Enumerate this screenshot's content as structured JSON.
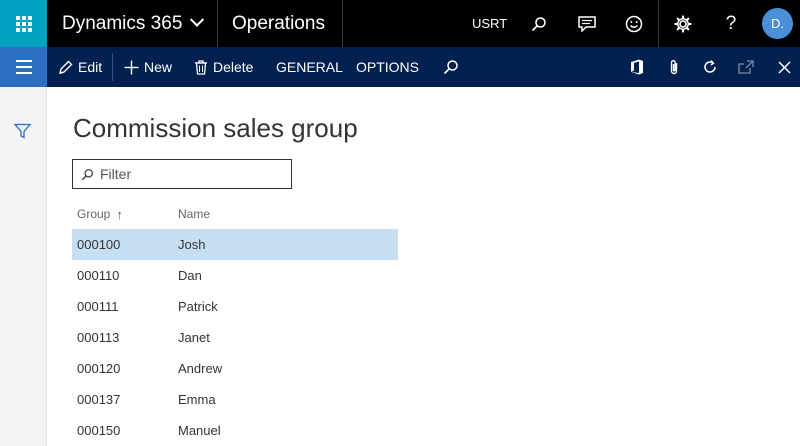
{
  "topbar": {
    "brand": "Dynamics 365",
    "module": "Operations",
    "company": "USRT",
    "avatar_initials": "D."
  },
  "actionbar": {
    "edit": "Edit",
    "new": "New",
    "delete": "Delete",
    "general": "GENERAL",
    "options": "OPTIONS"
  },
  "page": {
    "title": "Commission sales group",
    "filter_placeholder": "Filter"
  },
  "grid": {
    "columns": {
      "group": "Group",
      "name": "Name"
    },
    "sort_indicator": "↑",
    "rows": [
      {
        "group": "000100",
        "name": "Josh",
        "selected": true
      },
      {
        "group": "000110",
        "name": "Dan"
      },
      {
        "group": "000111",
        "name": "Patrick"
      },
      {
        "group": "000113",
        "name": "Janet"
      },
      {
        "group": "000120",
        "name": "Andrew"
      },
      {
        "group": "000137",
        "name": "Emma"
      },
      {
        "group": "000150",
        "name": "Manuel"
      }
    ]
  },
  "colors": {
    "waffle": "#00a3bf",
    "topbar": "#000000",
    "actionbar": "#002050",
    "hamburger": "#2c6fc0",
    "selected_row": "#c7dff3"
  }
}
